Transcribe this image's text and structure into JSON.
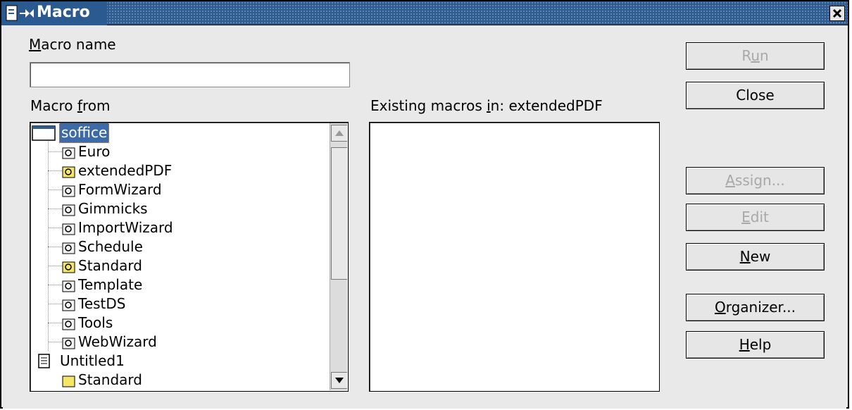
{
  "window": {
    "title": "Macro"
  },
  "macro_name": {
    "label": "Macro name",
    "value": ""
  },
  "macro_from": {
    "label": "Macro from"
  },
  "existing": {
    "label": "Existing macros in: extendedPDF"
  },
  "tree": {
    "root": "soffice",
    "libraries": [
      "Euro",
      "extendedPDF",
      "FormWizard",
      "Gimmicks",
      "ImportWizard",
      "Schedule",
      "Standard",
      "Template",
      "TestDS",
      "Tools",
      "WebWizard"
    ],
    "document": "Untitled1",
    "document_child": "Standard"
  },
  "buttons": {
    "run": "Run",
    "close": "Close",
    "assign": "Assign...",
    "edit": "Edit",
    "new": "New",
    "organizer": "Organizer...",
    "help": "Help"
  },
  "colors": {
    "titlebar": "#2f5c8f",
    "selection": "#3d6aa8",
    "dialog_bg": "#e9e9e9"
  }
}
